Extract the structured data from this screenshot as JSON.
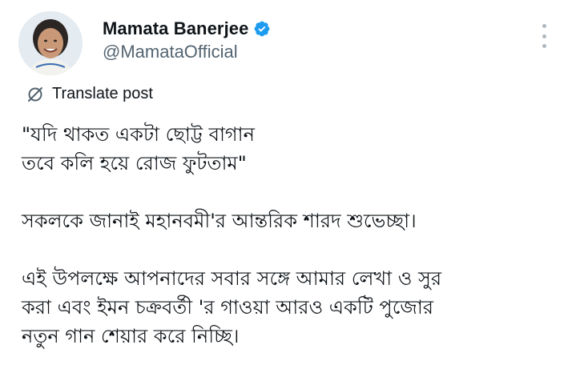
{
  "author": {
    "display_name": "Mamata Banerjee",
    "handle": "@MamataOfficial",
    "verified_icon": "verified-badge-icon",
    "verified_color": "#1d9bf0"
  },
  "actions": {
    "more_icon": "more-vertical-icon"
  },
  "translate": {
    "icon": "translate-icon",
    "label": "Translate post"
  },
  "post": {
    "lines": [
      "\"যদি থাকত একটা ছোট্ট বাগান",
      "তবে কলি হয়ে রোজ ফুটতাম\"",
      "সকলকে জানাই মহানবমী'র আন্তরিক শারদ শুভেচ্ছা।",
      "এই উপলক্ষে আপনাদের সবার সঙ্গে আমার লেখা ও সুর",
      "করা এবং ইমন চক্রবর্তী 'র গাওয়া আরও একটি পুজোর",
      "নতুন গান শেয়ার করে নিচ্ছি।"
    ]
  },
  "colors": {
    "text_primary": "#0f1419",
    "text_secondary": "#536471"
  }
}
